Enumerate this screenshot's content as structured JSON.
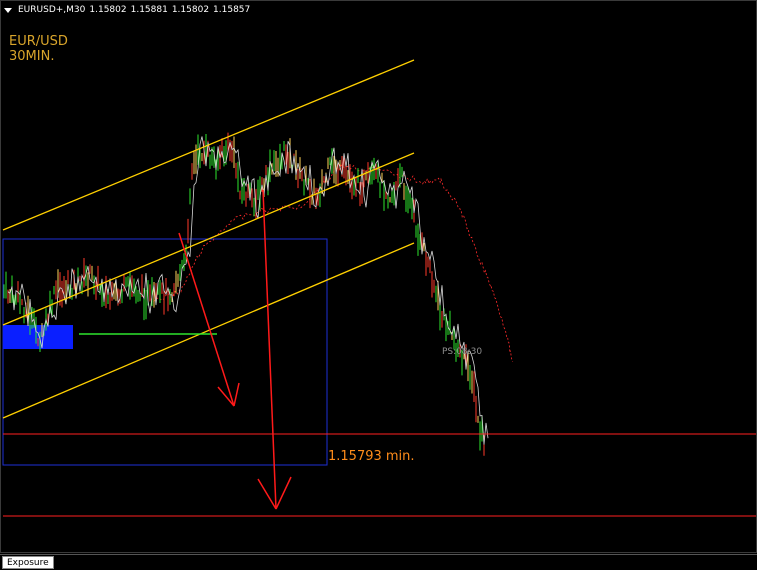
{
  "chart": {
    "symbol": "EURUSD+,M30",
    "ohlc": [
      "1.15802",
      "1.15881",
      "1.15802",
      "1.15857"
    ]
  },
  "annotations": {
    "pair": "EUR/USD",
    "timeframe": "30MIN.",
    "min_label": "1.15793 min.",
    "ps_label": "PS:08:30"
  },
  "tabs": [
    {
      "label": "Exposure"
    }
  ],
  "colors": {
    "background": "#000000",
    "channel": "#ffd000",
    "arrow": "#ff1a1a",
    "support": "#ff2020",
    "box": "#1e2fd6",
    "zone": "#0a1fff",
    "shadow_line": "#d8d8d8",
    "dotted": "#ff2a2a",
    "title": "#d9a52b",
    "min_text": "#ff8c1a",
    "green": "#2ee62e"
  },
  "icons": {
    "menu": "triangle-down-icon"
  }
}
